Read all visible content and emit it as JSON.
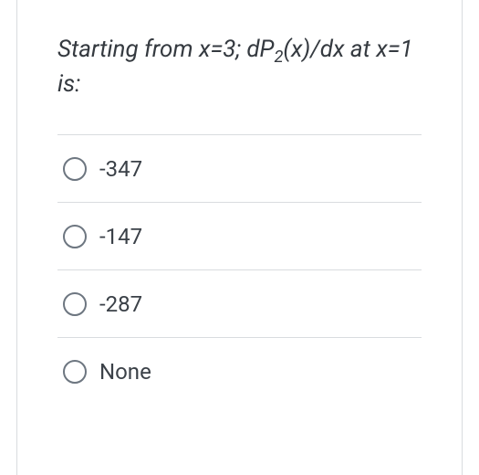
{
  "question": {
    "prefix": "Starting from x=3; dP",
    "subscript": "2",
    "suffix": "(x)/dx at x=1 is:"
  },
  "options": [
    {
      "label": "-347"
    },
    {
      "label": "-147"
    },
    {
      "label": "-287"
    },
    {
      "label": "None"
    }
  ]
}
